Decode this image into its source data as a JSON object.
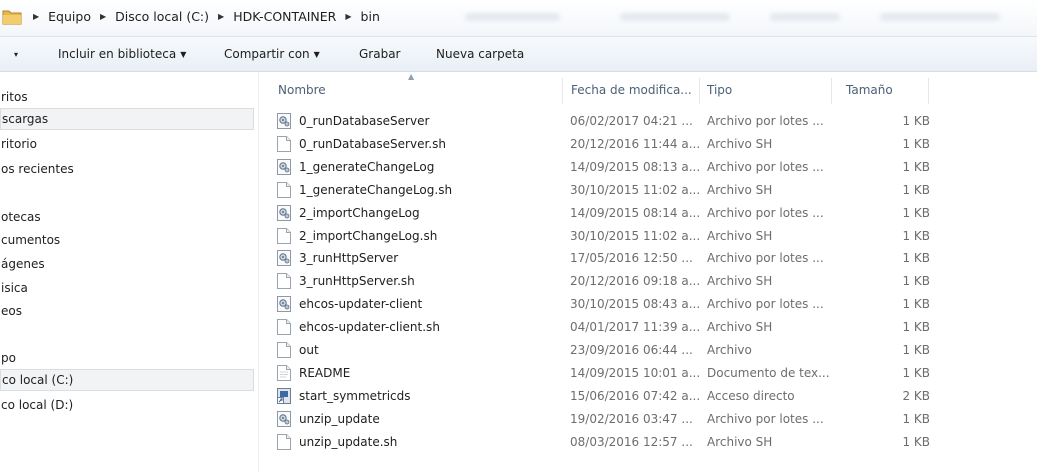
{
  "address": {
    "crumbs": [
      "Equipo",
      "Disco local (C:)",
      "HDK-CONTAINER",
      "bin"
    ]
  },
  "toolbar": {
    "organize_dropdown": "▾",
    "include_library": "Incluir en biblioteca",
    "share_with": "Compartir con",
    "burn": "Grabar",
    "new_folder": "Nueva carpeta"
  },
  "nav": {
    "items": [
      "ritos",
      "scargas",
      "ritorio",
      "os recientes",
      "otecas",
      "cumentos",
      "ágenes",
      "isica",
      "eos",
      "po",
      "co local (C:)",
      "co local (D:)"
    ]
  },
  "columns": {
    "name": "Nombre",
    "date": "Fecha de modifica...",
    "type": "Tipo",
    "size": "Tamaño"
  },
  "files": [
    {
      "name": "0_runDatabaseServer",
      "date": "06/02/2017 04:21 ...",
      "type": "Archivo por lotes ...",
      "size": "1 KB",
      "icon": "batch-file-icon"
    },
    {
      "name": "0_runDatabaseServer.sh",
      "date": "20/12/2016 11:44 a...",
      "type": "Archivo SH",
      "size": "1 KB",
      "icon": "document-icon"
    },
    {
      "name": "1_generateChangeLog",
      "date": "14/09/2015 08:13 a...",
      "type": "Archivo por lotes ...",
      "size": "1 KB",
      "icon": "batch-file-icon"
    },
    {
      "name": "1_generateChangeLog.sh",
      "date": "30/10/2015 11:02 a...",
      "type": "Archivo SH",
      "size": "1 KB",
      "icon": "document-icon"
    },
    {
      "name": "2_importChangeLog",
      "date": "14/09/2015 08:14 a...",
      "type": "Archivo por lotes ...",
      "size": "1 KB",
      "icon": "batch-file-icon"
    },
    {
      "name": "2_importChangeLog.sh",
      "date": "30/10/2015 11:02 a...",
      "type": "Archivo SH",
      "size": "1 KB",
      "icon": "document-icon"
    },
    {
      "name": "3_runHttpServer",
      "date": "17/05/2016 12:50 ...",
      "type": "Archivo por lotes ...",
      "size": "1 KB",
      "icon": "batch-file-icon"
    },
    {
      "name": "3_runHttpServer.sh",
      "date": "20/12/2016 09:18 a...",
      "type": "Archivo SH",
      "size": "1 KB",
      "icon": "document-icon"
    },
    {
      "name": "ehcos-updater-client",
      "date": "30/10/2015 08:43 a...",
      "type": "Archivo por lotes ...",
      "size": "1 KB",
      "icon": "batch-file-icon"
    },
    {
      "name": "ehcos-updater-client.sh",
      "date": "04/01/2017 11:39 a...",
      "type": "Archivo SH",
      "size": "1 KB",
      "icon": "document-icon"
    },
    {
      "name": "out",
      "date": "23/09/2016 06:44 ...",
      "type": "Archivo",
      "size": "1 KB",
      "icon": "document-icon"
    },
    {
      "name": "README",
      "date": "14/09/2015 10:01 a...",
      "type": "Documento de tex...",
      "size": "1 KB",
      "icon": "text-document-icon"
    },
    {
      "name": "start_symmetricds",
      "date": "15/06/2016 07:42 a...",
      "type": "Acceso directo",
      "size": "2 KB",
      "icon": "shortcut-icon"
    },
    {
      "name": "unzip_update",
      "date": "19/02/2016 03:47 ...",
      "type": "Archivo por lotes ...",
      "size": "1 KB",
      "icon": "batch-file-icon"
    },
    {
      "name": "unzip_update.sh",
      "date": "08/03/2016 12:57 ...",
      "type": "Archivo SH",
      "size": "1 KB",
      "icon": "document-icon"
    }
  ]
}
